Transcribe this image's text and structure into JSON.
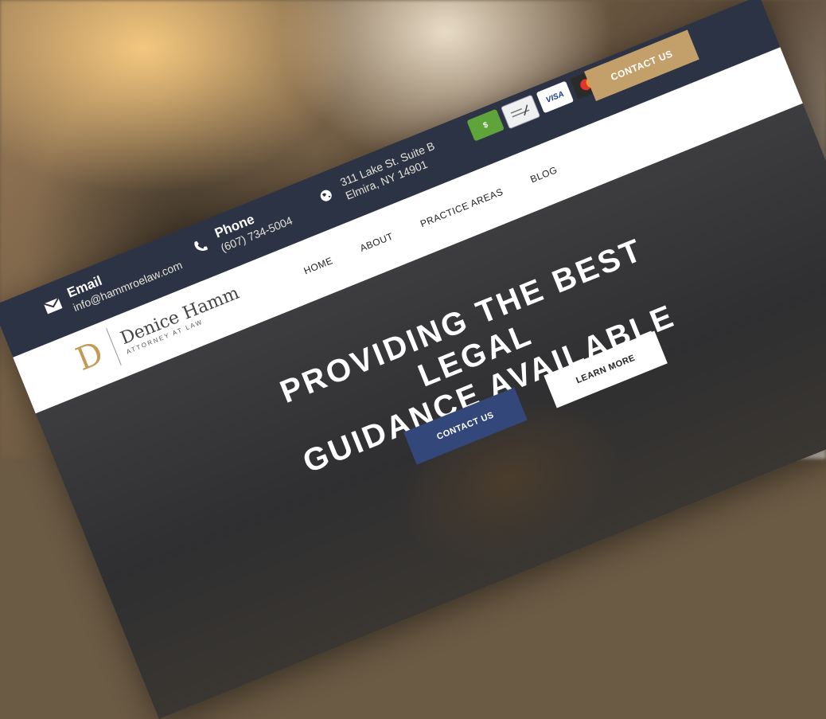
{
  "topbar": {
    "email": {
      "icon": "envelope-icon",
      "title": "Email",
      "value": "info@hammroelaw.com"
    },
    "phone": {
      "icon": "phone-icon",
      "title": "Phone",
      "value": "(607) 734-5004"
    },
    "address": {
      "icon": "globe-icon",
      "line1": "311 Lake St. Suite B",
      "line2": "Elmira, NY 14901"
    },
    "payments": [
      {
        "icon": "cash-icon",
        "label": "$"
      },
      {
        "icon": "check-icon",
        "label": ""
      },
      {
        "icon": "visa-icon",
        "label": "VISA"
      },
      {
        "icon": "mastercard-icon",
        "label": ""
      }
    ],
    "contact_label": "CONTACT US"
  },
  "brand": {
    "mark": "D",
    "name": "Denice Hamm",
    "tagline": "ATTORNEY AT LAW"
  },
  "nav": {
    "items": [
      "HOME",
      "ABOUT",
      "PRACTICE AREAS",
      "BLOG"
    ]
  },
  "hero": {
    "title_line1": "PROVIDING THE BEST LEGAL",
    "title_line2": "GUIDANCE AVAILABLE",
    "learn_more_label": "LEARN MORE",
    "contact_label": "CONTACT US"
  },
  "colors": {
    "topbar": "#2c3345",
    "gold": "#c3a06a",
    "hero_button_blue": "#33477a"
  }
}
